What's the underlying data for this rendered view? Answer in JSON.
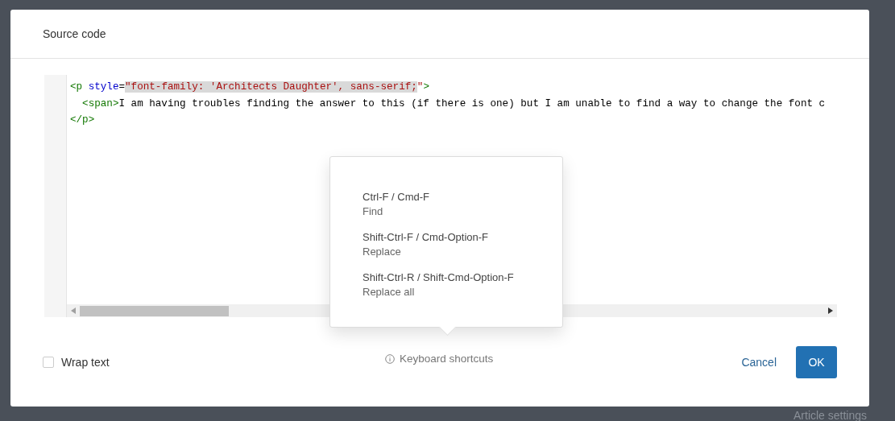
{
  "dialog": {
    "title": "Source code",
    "code_lines": [
      [
        {
          "kind": "tag",
          "text": "<p "
        },
        {
          "kind": "attribute",
          "text": "style"
        },
        {
          "kind": "plain",
          "text": "="
        },
        {
          "kind": "string",
          "text": "\"font-family: 'Architects Daughter', sans-serif;",
          "selected": true
        },
        {
          "kind": "string",
          "text": "\""
        },
        {
          "kind": "tag",
          "text": ">"
        }
      ],
      [
        {
          "kind": "tag",
          "text": "<span>",
          "indented": true
        },
        {
          "kind": "plain",
          "text": "I am having troubles finding the answer to this (if there is one) but I am unable to find a way to change the font c"
        }
      ],
      [
        {
          "kind": "tag",
          "text": "</p>"
        }
      ]
    ],
    "shortcuts_popover": {
      "items": [
        {
          "keys": "Ctrl-F / Cmd-F",
          "action": "Find"
        },
        {
          "keys": "Shift-Ctrl-F / Cmd-Option-F",
          "action": "Replace"
        },
        {
          "keys": "Shift-Ctrl-R / Shift-Cmd-Option-F",
          "action": "Replace all"
        }
      ]
    },
    "wrap_text": {
      "label": "Wrap text",
      "checked": false
    },
    "shortcuts_link": "Keyboard shortcuts",
    "buttons": {
      "cancel": "Cancel",
      "ok": "OK"
    }
  },
  "background": {
    "panel_label": "Article settings"
  }
}
